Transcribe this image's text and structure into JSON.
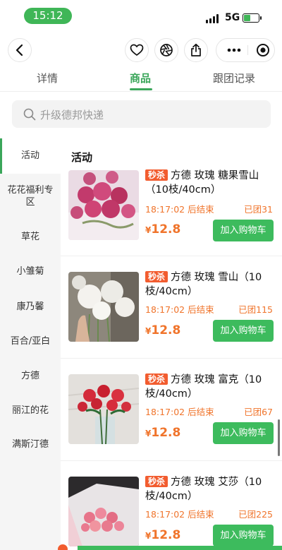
{
  "status_bar": {
    "time": "15:12",
    "network": "5G",
    "battery_level": 0.35
  },
  "nav": {
    "icons": {
      "back": "chevron-left-icon",
      "favorite": "heart-icon",
      "camera": "aperture-icon",
      "share": "share-icon",
      "more": "more-dots-icon",
      "close": "target-icon"
    }
  },
  "tabs": [
    {
      "label": "详情"
    },
    {
      "label": "商品",
      "active": true
    },
    {
      "label": "跟团记录"
    }
  ],
  "search": {
    "placeholder": "升级德邦快递"
  },
  "sidebar": {
    "items": [
      {
        "label": "活动",
        "active": true
      },
      {
        "label": "花花福利专区"
      },
      {
        "label": "草花"
      },
      {
        "label": "小雏菊"
      },
      {
        "label": "康乃馨"
      },
      {
        "label": "百合/亚白"
      },
      {
        "label": "方德"
      },
      {
        "label": "丽江的花"
      },
      {
        "label": "满斯汀德"
      }
    ]
  },
  "section": {
    "title": "活动"
  },
  "products": [
    {
      "tag": "秒杀",
      "name": "方德 玫瑰 糖果雪山（10枝/40cm）",
      "countdown": "18:17:02 后结束",
      "grouped": "已团31",
      "currency": "¥",
      "price": "12.8",
      "cart_label": "加入购物车"
    },
    {
      "tag": "秒杀",
      "name": "方德 玫瑰 雪山（10枝/40cm）",
      "countdown": "18:17:02 后结束",
      "grouped": "已团115",
      "currency": "¥",
      "price": "12.8",
      "cart_label": "加入购物车"
    },
    {
      "tag": "秒杀",
      "name": "方德 玫瑰 富克（10枝/40cm）",
      "countdown": "18:17:02 后结束",
      "grouped": "已团67",
      "currency": "¥",
      "price": "12.8",
      "cart_label": "加入购物车"
    },
    {
      "tag": "秒杀",
      "name": "方德 玫瑰 艾莎（10枝/40cm）",
      "countdown": "18:17:02 后结束",
      "grouped": "已团225",
      "currency": "¥",
      "price": "12.8",
      "cart_label": "加入购物车"
    }
  ],
  "colors": {
    "accent": "#3aa65a",
    "cart": "#3dbb5d",
    "price": "#f0742b",
    "tag": "#f25c2f"
  }
}
